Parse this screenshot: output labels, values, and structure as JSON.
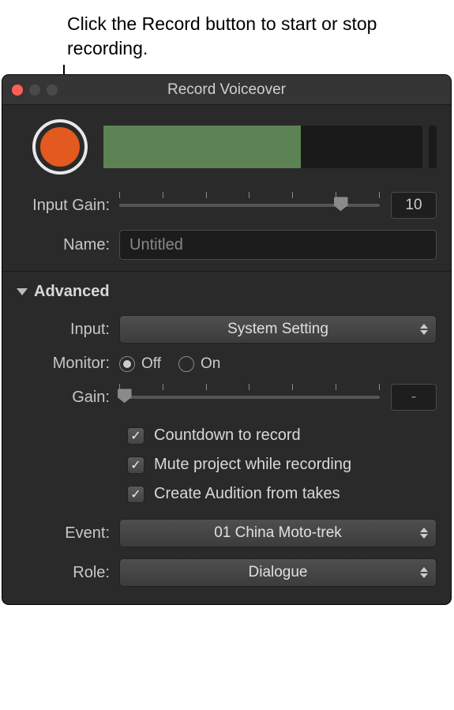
{
  "callout": "Click the Record button to start or stop recording.",
  "window": {
    "title": "Record Voiceover"
  },
  "inputGain": {
    "label": "Input Gain:",
    "value": "10",
    "position_pct": 85
  },
  "name": {
    "label": "Name:",
    "value": "Untitled"
  },
  "advanced": {
    "header": "Advanced",
    "input": {
      "label": "Input:",
      "selected": "System Setting"
    },
    "monitor": {
      "label": "Monitor:",
      "options": {
        "off": "Off",
        "on": "On"
      },
      "selected": "off"
    },
    "gain": {
      "label": "Gain:",
      "value": "-",
      "position_pct": 2
    },
    "checks": {
      "countdown": "Countdown to record",
      "mute": "Mute project while recording",
      "audition": "Create Audition from takes"
    },
    "event": {
      "label": "Event:",
      "selected": "01 China Moto-trek"
    },
    "role": {
      "label": "Role:",
      "selected": "Dialogue"
    }
  }
}
